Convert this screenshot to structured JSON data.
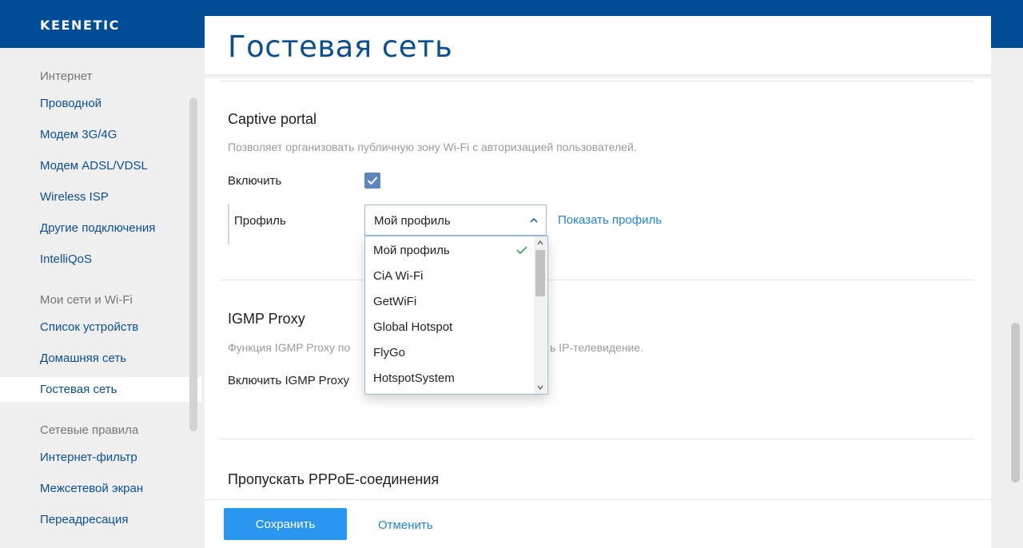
{
  "brand": {
    "logo": "KEENETIC"
  },
  "sidebar": {
    "groups": [
      {
        "label": "Интернет",
        "items": [
          "Проводной",
          "Модем 3G/4G",
          "Модем ADSL/VDSL",
          "Wireless ISP",
          "Другие подключения",
          "IntelliQoS"
        ]
      },
      {
        "label": "Мои сети и Wi-Fi",
        "items": [
          "Список устройств",
          "Домашняя сеть",
          "Гостевая сеть"
        ]
      },
      {
        "label": "Сетевые правила",
        "items": [
          "Интернет-фильтр",
          "Межсетевой экран",
          "Переадресация"
        ]
      }
    ],
    "active": "Гостевая сеть"
  },
  "page": {
    "title": "Гостевая сеть"
  },
  "captive": {
    "title": "Captive portal",
    "desc": "Позволяет организовать публичную зону Wi-Fi с авторизацией пользователей.",
    "enable_label": "Включить",
    "enabled": true,
    "profile_label": "Профиль",
    "profile_value": "Мой профиль",
    "show_profile": "Показать профиль",
    "options": [
      "Мой профиль",
      "CiA Wi-Fi",
      "GetWiFi",
      "Global Hotspot",
      "FlyGo",
      "HotspotSystem"
    ],
    "selected_option": "Мой профиль"
  },
  "igmp": {
    "title": "IGMP Proxy",
    "desc_left": "Функция IGMP Proxy по",
    "desc_right": "ь IP-телевидение.",
    "enable_label": "Включить IGMP Proxy"
  },
  "pppoe": {
    "title": "Пропускать PPPoE-соединения"
  },
  "footer": {
    "save": "Сохранить",
    "cancel": "Отменить"
  },
  "colors": {
    "brand": "#004c97",
    "accent": "#2b96f0",
    "link": "#1f84dd",
    "nav": "#0b4f93"
  },
  "icons": {
    "check": "checkmark-icon",
    "chevron": "chevron-up-icon"
  }
}
